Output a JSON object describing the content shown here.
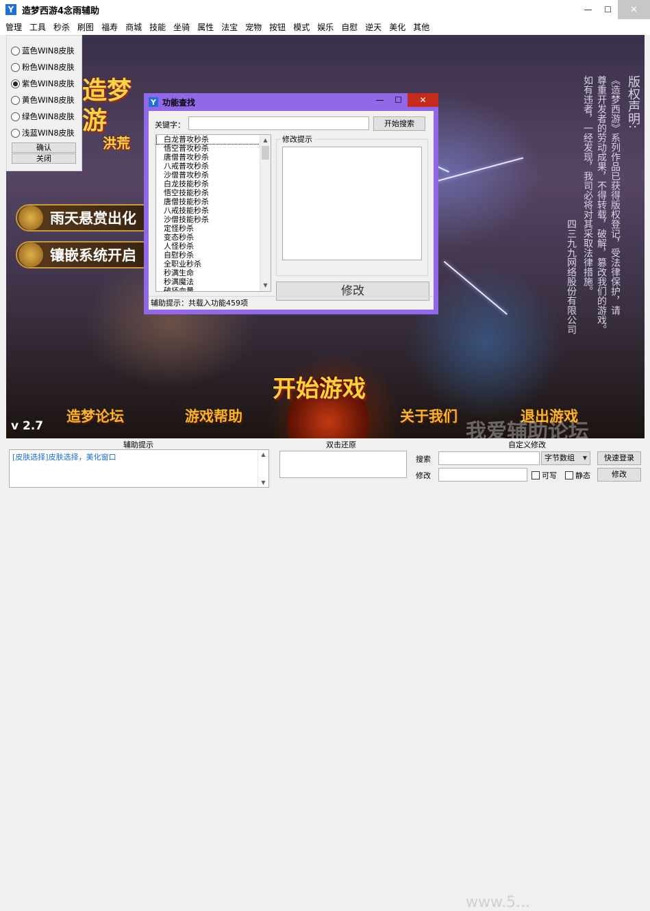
{
  "window": {
    "title": "造梦西游4念雨辅助",
    "app_icon": "Y",
    "minimize": "—",
    "maximize": "☐",
    "close": "✕"
  },
  "menu": [
    "管理",
    "工具",
    "秒杀",
    "刷图",
    "福寿",
    "商城",
    "技能",
    "坐骑",
    "属性",
    "法宝",
    "宠物",
    "按钮",
    "模式",
    "娱乐",
    "自慰",
    "逆天",
    "美化",
    "其他"
  ],
  "skins": {
    "options": [
      "蓝色WIN8皮肤",
      "粉色WIN8皮肤",
      "紫色WIN8皮肤",
      "黄色WIN8皮肤",
      "绿色WIN8皮肤",
      "浅蓝WIN8皮肤"
    ],
    "selected_index": 2,
    "confirm": "确认",
    "close": "关闭"
  },
  "game": {
    "logo": "造梦游",
    "logo_sub": "洪荒",
    "banners": [
      "雨天悬赏出化",
      "镶嵌系统开启"
    ],
    "copyright_title": "版权声明:",
    "copyright_lines": [
      "《造梦西游》系列作品已获得版权登记，受法律保护，请",
      "尊重开发者的劳动成果，不得转载，破解，篡改我们的游戏。",
      "如有违者，一经发现，我司必将对其采取法律措施。",
      "四三九九网络股份有限公司"
    ],
    "version": "v 2.7",
    "links": [
      "造梦论坛",
      "游戏帮助",
      "关于我们",
      "退出游戏"
    ],
    "start": "开始游戏",
    "watermark": "我爱辅助论坛",
    "watermark_url": "www.5..."
  },
  "dialog": {
    "title": "功能查找",
    "icon": "Y",
    "minimize": "—",
    "maximize": "☐",
    "close": "✕",
    "keyword_label": "关键字：",
    "keyword_value": "",
    "search_button": "开始搜索",
    "functions": [
      "白龙普攻秒杀",
      "悟空普攻秒杀",
      "唐僧普攻秒杀",
      "八戒普攻秒杀",
      "沙僧普攻秒杀",
      "白龙技能秒杀",
      "悟空技能秒杀",
      "唐僧技能秒杀",
      "八戒技能秒杀",
      "沙僧技能秒杀",
      "定怪秒杀",
      "变态秒杀",
      "人怪秒杀",
      "自慰秒杀",
      "全职业秒杀",
      "秒满生命",
      "秒满魔法",
      "破坏血量"
    ],
    "hint_group_title": "修改提示",
    "modify_button": "修改",
    "status": "辅助提示：共载入功能459项"
  },
  "bottom": {
    "log_header": "辅助提示",
    "log_text": "[皮肤选择]皮肤选择，美化窗口",
    "restore_header": "双击还原",
    "custom_header": "自定义修改",
    "search_label": "搜索",
    "search_value": "",
    "modify_label": "修改",
    "modify_value": "",
    "combo_value": "字节数组",
    "quick_login": "快速登录",
    "writable": "可写",
    "static": "静态",
    "modify_button": "修改"
  }
}
